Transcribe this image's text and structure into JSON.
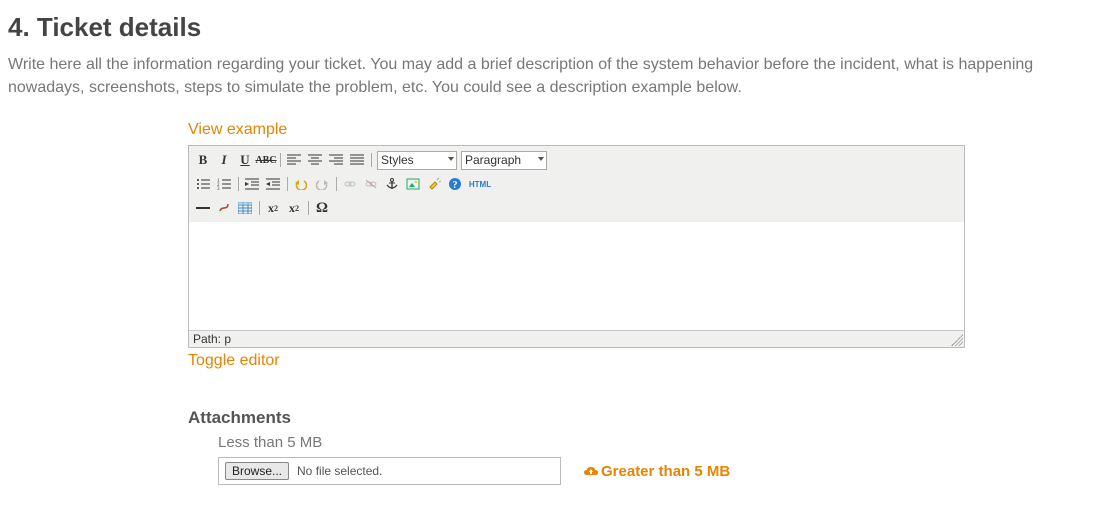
{
  "section": {
    "title": "4. Ticket details",
    "description": "Write here all the information regarding your ticket. You may add a brief description of the system behavior before the incident, what is happening nowadays, screenshots, steps to simulate the problem, etc. You could see a description example below."
  },
  "links": {
    "view_example": "View example",
    "toggle_editor": "Toggle editor"
  },
  "editor": {
    "styles_label": "Styles",
    "paragraph_label": "Paragraph",
    "path_label": "Path: p",
    "html_label": "HTML"
  },
  "attachments": {
    "title": "Attachments",
    "less_label": "Less than 5 MB",
    "browse_label": "Browse...",
    "no_file_label": "No file selected.",
    "greater_label": "Greater than 5 MB"
  }
}
